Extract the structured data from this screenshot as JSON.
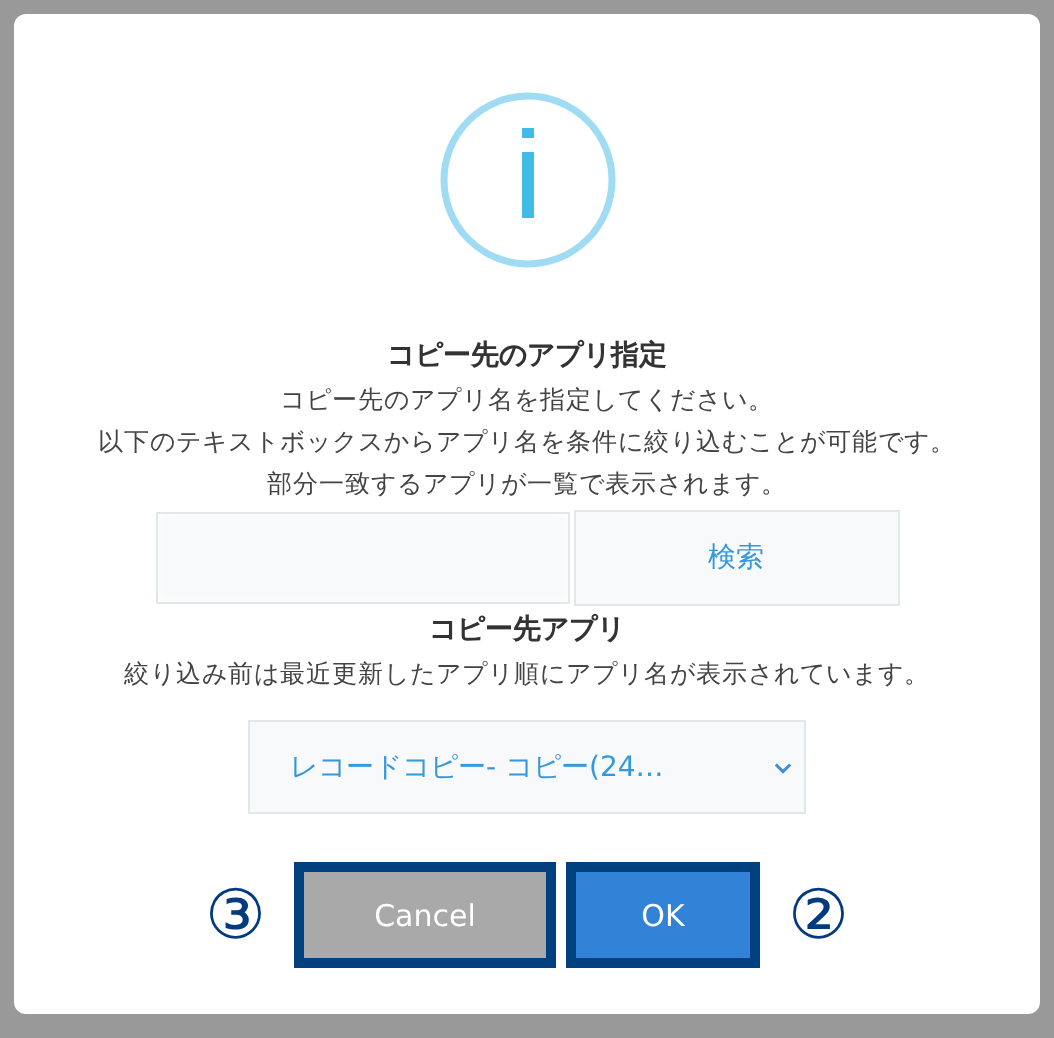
{
  "dialog": {
    "title": "コピー先のアプリ指定",
    "description": [
      "コピー先のアプリ名を指定してください。",
      "以下のテキストボックスからアプリ名を条件に絞り込むことが可能です。",
      "部分一致するアプリが一覧で表示されます。"
    ],
    "search_button": "検索",
    "app_label": "コピー先アプリ",
    "app_note": "絞り込み前は最近更新したアプリ順にアプリ名が表示されています。",
    "app_select": "レコードコピー- コピー(24…",
    "buttons": [
      {
        "label": "Cancel",
        "kind": "cancel",
        "callout": "③"
      },
      {
        "label": "OK",
        "kind": "ok",
        "callout": "②"
      }
    ]
  }
}
